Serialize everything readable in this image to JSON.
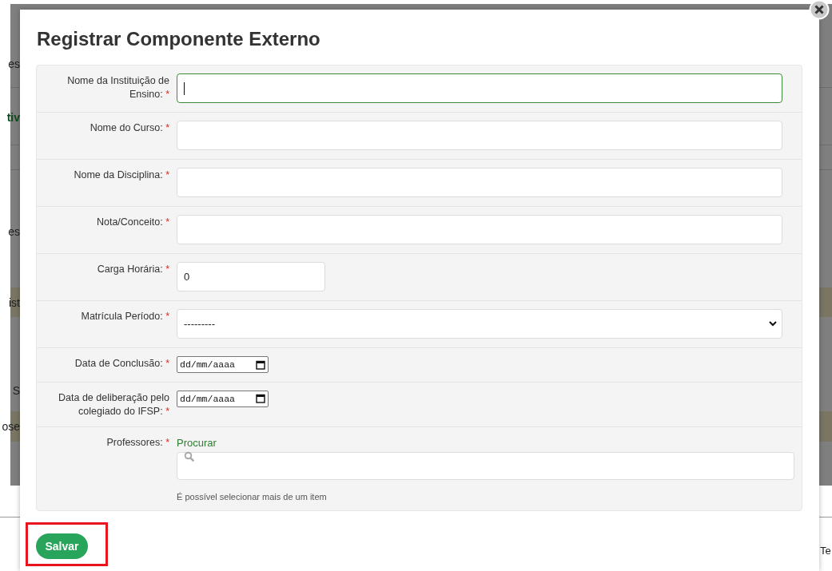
{
  "background": {
    "rows": [
      {
        "kind": "text",
        "text": "es"
      },
      {
        "kind": "link",
        "text": "tiv"
      },
      {
        "kind": "blank"
      },
      {
        "kind": "text",
        "text": "es"
      },
      {
        "kind": "band",
        "text": "ist"
      },
      {
        "kind": "text",
        "text": "S"
      },
      {
        "kind": "band",
        "text": "ose"
      },
      {
        "kind": "blank"
      }
    ],
    "footer_text": "Te"
  },
  "dialog": {
    "title": "Registrar Componente Externo",
    "fields": [
      {
        "kind": "text",
        "label": "Nome da Instituição de Ensino:",
        "required_mark": "*",
        "focused": true
      },
      {
        "kind": "text",
        "label": "Nome do Curso:",
        "required_mark": "*",
        "focused": false
      },
      {
        "kind": "text",
        "label": "Nome da Disciplina:",
        "required_mark": "*",
        "focused": false
      },
      {
        "kind": "text",
        "label": "Nota/Conceito:",
        "required_mark": "*",
        "focused": false
      },
      {
        "kind": "number",
        "label": "Carga Horária:",
        "required_mark": "*",
        "value": "0",
        "focused": false
      },
      {
        "kind": "select",
        "label": "Matrícula Período:",
        "required_mark": "*",
        "value": "---------"
      },
      {
        "kind": "date",
        "label": "Data de Conclusão:",
        "required_mark": "*",
        "placeholder": "dd/mm/aaaa"
      },
      {
        "kind": "date",
        "label": "Data de deliberação pelo colegiado do IFSP:",
        "required_mark": "*",
        "placeholder": "dd/mm/aaaa"
      },
      {
        "kind": "search",
        "label": "Professores:",
        "required_mark": "*",
        "link": "Procurar",
        "help": "É possível selecionar mais de um item"
      }
    ],
    "save_button": "Salvar",
    "save_highlighted": true
  }
}
